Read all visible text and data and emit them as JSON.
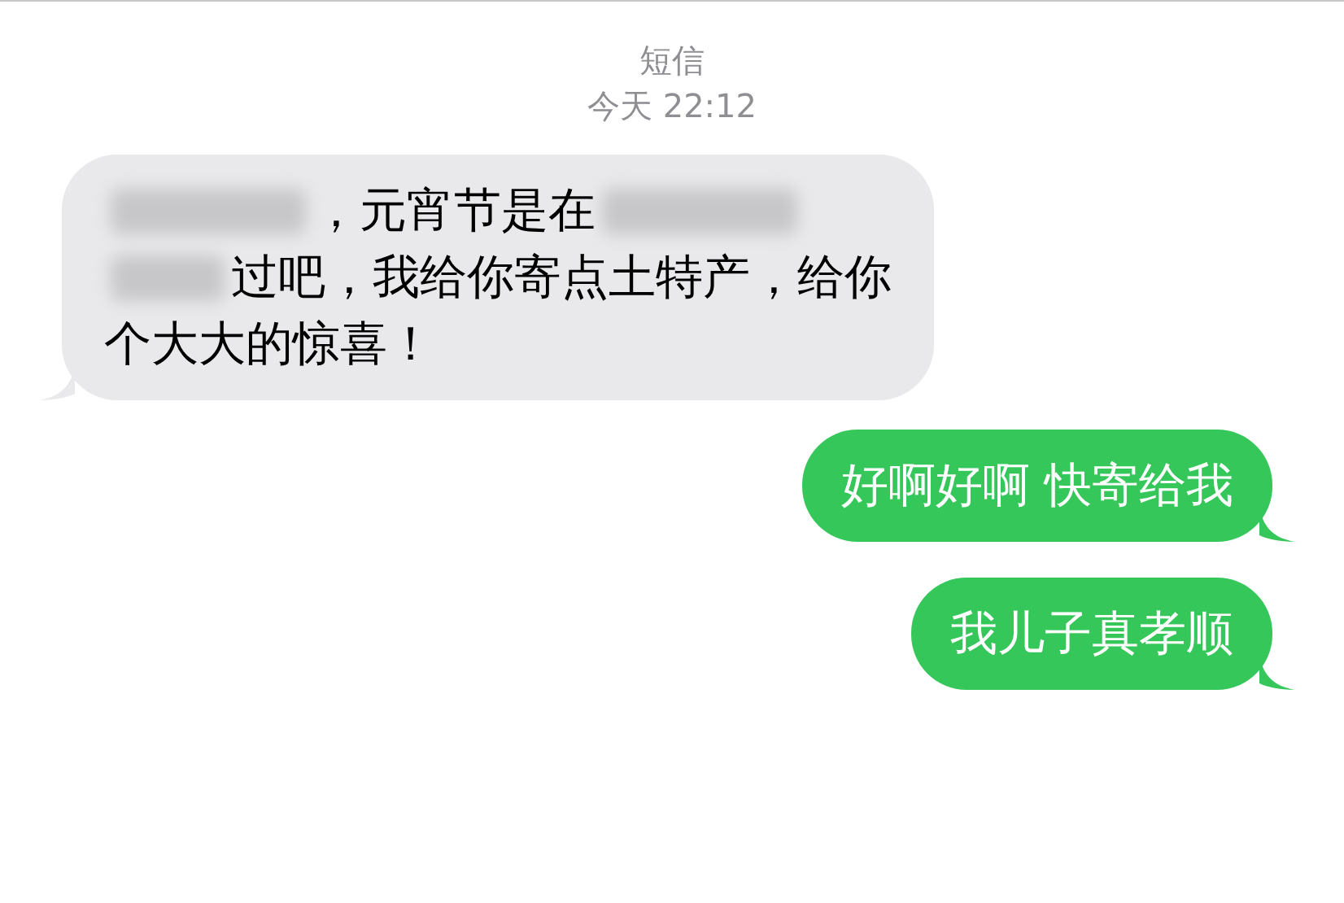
{
  "header": {
    "title": "短信",
    "timestamp": "今天 22:12"
  },
  "messages": [
    {
      "kind": "incoming",
      "lines": [
        [
          {
            "kind": "blurred"
          },
          {
            "kind": "text",
            "text": "，元宵节是在"
          },
          {
            "kind": "blurred"
          }
        ],
        [
          {
            "kind": "blurred"
          },
          {
            "kind": "text",
            "text": "过吧，我给你寄点土特产，给你"
          }
        ],
        [
          {
            "kind": "text",
            "text": "个大大的惊喜！"
          }
        ]
      ]
    },
    {
      "kind": "outgoing",
      "lines": [
        [
          {
            "kind": "text",
            "text": "好啊好啊 快寄给我"
          }
        ]
      ]
    },
    {
      "kind": "outgoing",
      "lines": [
        [
          {
            "kind": "text",
            "text": "我儿子真孝顺"
          }
        ]
      ]
    }
  ]
}
